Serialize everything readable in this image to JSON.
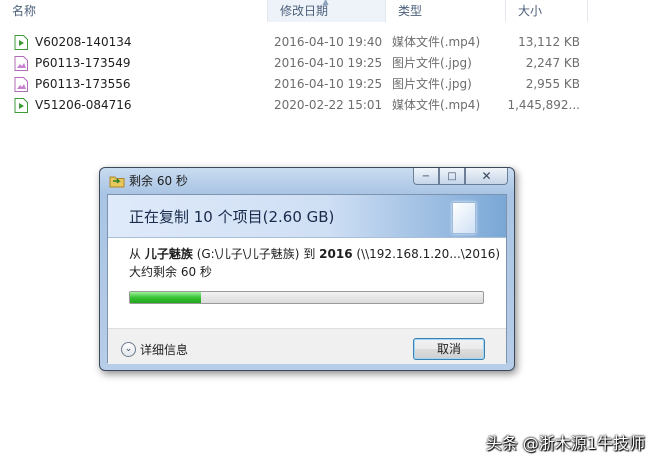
{
  "columns": {
    "name": "名称",
    "date": "修改日期",
    "type": "类型",
    "size": "大小"
  },
  "files": [
    {
      "name": "V60208-140134",
      "date": "2016-04-10 19:40",
      "type": "媒体文件(.mp4)",
      "size": "13,112 KB",
      "icon": "video-file-icon"
    },
    {
      "name": "P60113-173549",
      "date": "2016-04-10 19:25",
      "type": "图片文件(.jpg)",
      "size": "2,247 KB",
      "icon": "image-file-icon"
    },
    {
      "name": "P60113-173556",
      "date": "2016-04-10 19:25",
      "type": "图片文件(.jpg)",
      "size": "2,955 KB",
      "icon": "image-file-icon"
    },
    {
      "name": "V51206-084716",
      "date": "2020-02-22 15:01",
      "type": "媒体文件(.mp4)",
      "size": "1,445,892...",
      "icon": "video-file-icon"
    }
  ],
  "dialog": {
    "title": "剩余 60 秒",
    "heading": "正在复制 10 个项目(2.60 GB)",
    "from_word": "从",
    "source_name": "儿子魅族",
    "source_path": "(G:\\儿子\\儿子魅族)",
    "to_word": "到",
    "dest_name": "2016",
    "dest_path": "(\\\\192.168.1.20...\\2016)",
    "remaining": "大约剩余 60 秒",
    "progress_fraction": 0.2,
    "details_label": "详细信息",
    "cancel_label": "取消",
    "buttons": {
      "minimize": "−",
      "maximize": "□",
      "close": "✕"
    }
  },
  "watermark": "头条 @浙木源1牛技师",
  "colors": {
    "progress": "#2db42a",
    "accent": "#3c7fb1"
  }
}
